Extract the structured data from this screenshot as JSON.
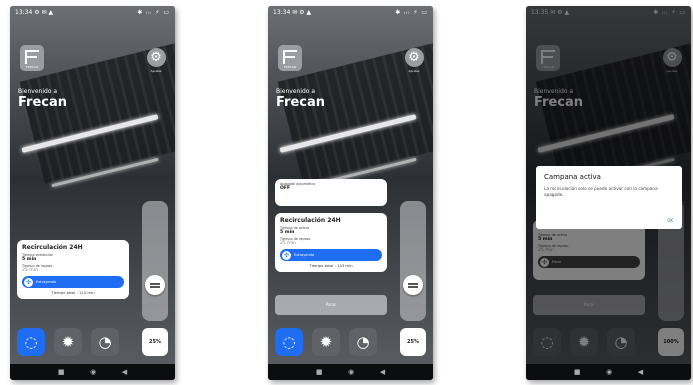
{
  "screens": [
    {
      "status": {
        "time": "13:34",
        "left_icons": "⚙ ✉ ▲",
        "right_icons": "✱ ᵢₗₗ ⚡ ▭"
      },
      "logo_text": "FRECAN",
      "settings_label": "Ajustes",
      "welcome": "Bienvenido a",
      "brand": "Frecan",
      "card": {
        "title": "Recirculación 24H",
        "key1": "Tiempo extracción",
        "val1": "5 min",
        "key2": "Tiempo de reposo",
        "val2": "25 min",
        "pill_label": "Extrayendo",
        "footer": "Tiempo total : 110 min"
      },
      "percent": "25%",
      "slider_level": 0.25
    },
    {
      "status": {
        "time": "13:34",
        "left_icons": "✉ ⚙ ▲",
        "right_icons": "✱ ᵢₗₗ ⚡ ▭"
      },
      "logo_text": "FRECAN",
      "settings_label": "Ajustes",
      "welcome": "Bienvenido a",
      "brand": "Frecan",
      "small_card": {
        "key": "Apagado automático",
        "val": "OFF"
      },
      "card": {
        "title": "Recirculación 24H",
        "key1": "Tiempo de activo",
        "val1": "5 min",
        "key2": "Tiempo de reposo",
        "val2": "25 min",
        "pill_label": "Extrayendo",
        "footer": "Tiempo total : 143 min"
      },
      "stop_label": "Parar",
      "percent": "25%",
      "slider_level": 0.25
    },
    {
      "status": {
        "time": "13:35",
        "left_icons": "✉ ⚙ ▲",
        "right_icons": "✱ ᵢₗₗ ⚡ ▭"
      },
      "logo_text": "FRECAN",
      "settings_label": "Ajustes",
      "welcome": "Bienvenido a",
      "brand": "Frecan",
      "card": {
        "title": "Recirculación 24H",
        "key1": "Tiempo de activo",
        "val1": "5 min",
        "key2": "Tiempo de reposo",
        "val2": "25 min",
        "pill_label": "Parar"
      },
      "stop_label": "Parar",
      "percent": "100%",
      "slider_level": 1.0,
      "dialog": {
        "title": "Campana activa",
        "text": "La recirculación solo se puede activar con la campana apagada.",
        "ok": "OK"
      }
    }
  ],
  "icons": {
    "mode1": "recirculation-icon",
    "mode2": "light-icon",
    "mode3": "timer-icon",
    "settings": "gear-icon",
    "fan": "fan-icon"
  },
  "colors": {
    "accent": "#1f6df2",
    "card": "#ffffff"
  }
}
